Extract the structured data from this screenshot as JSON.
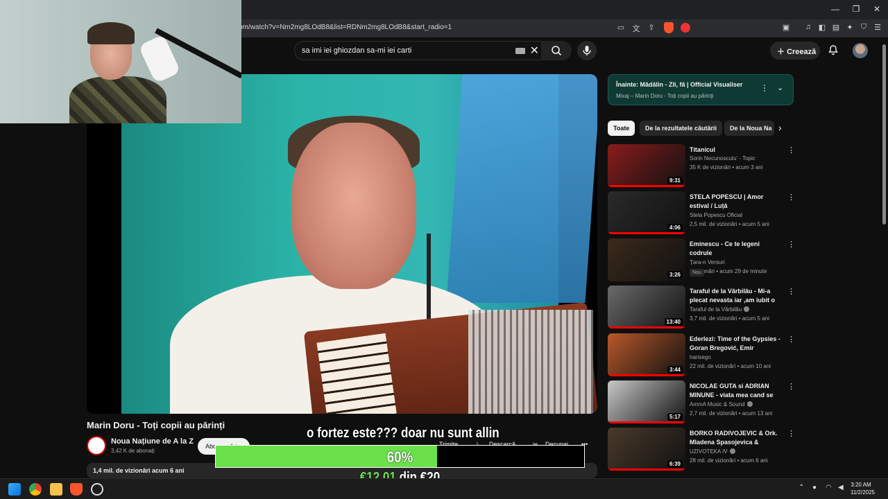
{
  "browser": {
    "url": "om/watch?v=Nm2mg8LOdB8&list=RDNm2mg8LOdB8&start_radio=1",
    "minimize": "—",
    "restore": "❐",
    "close": "✕"
  },
  "header": {
    "search_query": "sa imi iei ghiozdan sa-mi iei carti",
    "clear": "✕",
    "create_label": "Creează"
  },
  "video": {
    "title": "Marin Doru - Toți copii au părinți",
    "channel": "Noua Națiune de A la Z",
    "subscribers": "3,42 K de abonați",
    "subscribe_label": "Abonează-te",
    "actions": {
      "share": "Trimite",
      "download": "Descarcă",
      "clip": "Decupaj",
      "more": "•••"
    },
    "description_meta": "1,4 mil. de vizionări  acum 6 ani"
  },
  "overlay": {
    "caption": "o fortez este??? doar nu sunt allin",
    "goal_fraction": 0.6,
    "goal_percent": "60%",
    "goal_current": "€12.01",
    "goal_separator": " din ",
    "goal_target": "€20"
  },
  "sidebar": {
    "up_next": {
      "title": "Înainte: Mădălin - Zîi, fă | Official Visualiser",
      "subtitle": "Mixaj – Marin Doru - Toți copii au părinți"
    },
    "chips": [
      {
        "label": "Toate",
        "active": true
      },
      {
        "label": "De la rezultatele căutării",
        "active": false
      },
      {
        "label": "De la Noua Na",
        "active": false
      }
    ],
    "recommendations": [
      {
        "title": "Titanicul",
        "channel": "Sorin Necunoscutu' - Topic",
        "meta": "35 K de vizionări • acum 3 ani",
        "duration": "9:31",
        "thumb_color": "#8a1c1c",
        "watched": 1.0
      },
      {
        "title": "STELA POPESCU | Amor estival / Luță",
        "channel": "Stela Popescu Oficial",
        "meta": "2,5 mil. de vizionări • acum 5 ani",
        "duration": "4:06",
        "thumb_color": "#2a2a2a",
        "watched": 1.0
      },
      {
        "title": "Eminescu  - Ce te legeni codrule",
        "channel": "Țara-n Versuri",
        "meta": "3 vizionări • acum 29 de minute",
        "duration": "3:26",
        "badge": "Nou",
        "thumb_color": "#3a2a1a",
        "watched": 0
      },
      {
        "title": "Taraful de la Vărbilău - Mi-a plecat nevasta iar ,am iubit o ...",
        "channel": "Taraful de la Vărbilău",
        "meta": "3,7 mil. de vizionări • acum 5 ani",
        "duration": "13:40",
        "thumb_color": "#6a6a6a",
        "watched": 1.0,
        "verified": true
      },
      {
        "title": "Ederlezi: Time of the Gypsies - Goran Bregović, Emir Kusturica",
        "channel": "harisego",
        "meta": "22 mil. de vizionări • acum 10 ani",
        "duration": "3:44",
        "thumb_color": "#b8582a",
        "watched": 1.0
      },
      {
        "title": "NICOLAE GUTA si ADRIAN MINUNE - viata mea cand se v...",
        "channel": "AmmA Music & Sound",
        "meta": "2,7 mil. de vizionări • acum 13 ani",
        "duration": "5:17",
        "thumb_color": "#c8c8c8",
        "watched": 1.0,
        "verified": true
      },
      {
        "title": "BORKO RADIVOJEVIC & Ork. Mladena Spasojevica & Panter...",
        "channel": "UZIVOTEKA IV",
        "meta": "28 mil. de vizionări • acum 6 ani",
        "duration": "6:39",
        "thumb_color": "#4a3a2a",
        "watched": 1.0,
        "verified": true
      }
    ]
  },
  "taskbar": {
    "time": "3:20 AM",
    "date": "11/2/2025"
  }
}
